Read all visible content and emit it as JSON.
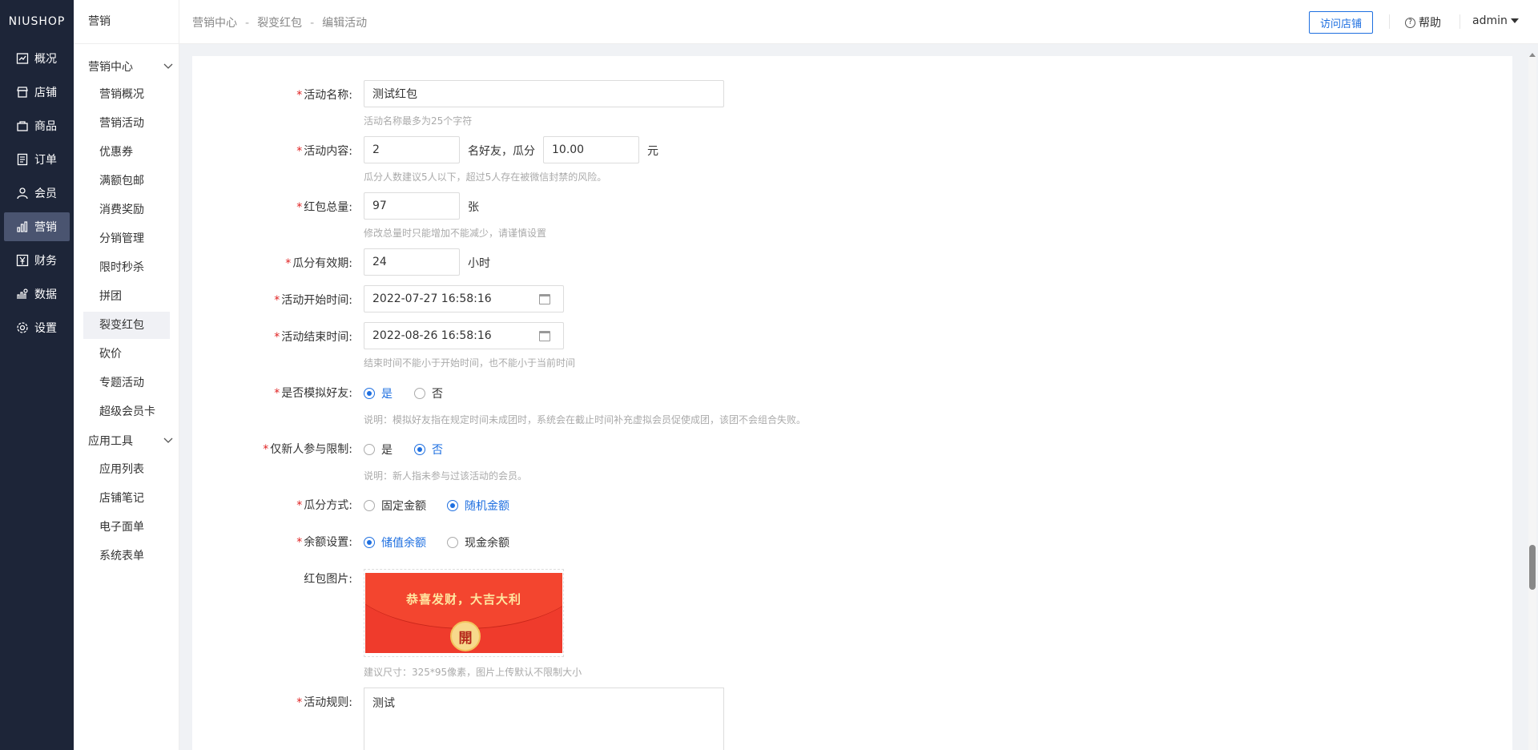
{
  "brand": "NIUSHOP",
  "nav": [
    {
      "label": "概况",
      "icon": "chart-line-icon"
    },
    {
      "label": "店铺",
      "icon": "store-icon"
    },
    {
      "label": "商品",
      "icon": "bag-icon"
    },
    {
      "label": "订单",
      "icon": "order-list-icon"
    },
    {
      "label": "会员",
      "icon": "user-icon"
    },
    {
      "label": "营销",
      "icon": "bar-chart-icon"
    },
    {
      "label": "财务",
      "icon": "yen-icon"
    },
    {
      "label": "数据",
      "icon": "data-icon"
    },
    {
      "label": "设置",
      "icon": "gear-icon"
    }
  ],
  "submenu": {
    "title": "营销",
    "group1": "营销中心",
    "group1_items": [
      "营销概况",
      "营销活动",
      "优惠券",
      "满额包邮",
      "消费奖励",
      "分销管理",
      "限时秒杀",
      "拼团",
      "裂变红包",
      "砍价",
      "专题活动",
      "超级会员卡"
    ],
    "group2": "应用工具",
    "group2_items": [
      "应用列表",
      "店铺笔记",
      "电子面单",
      "系统表单"
    ]
  },
  "header": {
    "crumbs": [
      "营销中心",
      "裂变红包",
      "编辑活动"
    ],
    "visit_store": "访问店铺",
    "help": "帮助",
    "user": "admin"
  },
  "form": {
    "name_label": "活动名称:",
    "name_value": "测试红包",
    "name_hint": "活动名称最多为25个字符",
    "content_label": "活动内容:",
    "content_count": "2",
    "content_mid": "名好友，瓜分",
    "content_amount": "10.00",
    "content_unit": "元",
    "content_hint": "瓜分人数建议5人以下，超过5人存在被微信封禁的风险。",
    "total_label": "红包总量:",
    "total_value": "97",
    "total_unit": "张",
    "total_hint": "修改总量时只能增加不能减少，请谨慎设置",
    "valid_label": "瓜分有效期:",
    "valid_value": "24",
    "valid_unit": "小时",
    "start_label": "活动开始时间:",
    "start_value": "2022-07-27 16:58:16",
    "end_label": "活动结束时间:",
    "end_value": "2022-08-26 16:58:16",
    "time_hint": "结束时间不能小于开始时间，也不能小于当前时间",
    "simulate_label": "是否模拟好友:",
    "simulate_yes": "是",
    "simulate_no": "否",
    "simulate_hint": "说明：模拟好友指在规定时间未成团时，系统会在截止时间补充虚拟会员促使成团，该团不会组合失败。",
    "newbie_label": "仅新人参与限制:",
    "newbie_yes": "是",
    "newbie_no": "否",
    "newbie_hint": "说明：新人指未参与过该活动的会员。",
    "split_label": "瓜分方式:",
    "split_fixed": "固定金额",
    "split_random": "随机金额",
    "balance_label": "余额设置:",
    "balance_stored": "储值余额",
    "balance_cash": "现金余额",
    "image_label": "红包图片:",
    "envelope_text": "恭喜发财，大吉大利",
    "envelope_button": "開",
    "image_hint": "建议尺寸：325*95像素，图片上传默认不限制大小",
    "rules_label": "活动规则:",
    "rules_value": "测试"
  },
  "colors": {
    "accent": "#1e6fe0",
    "nav_bg": "#1d2538",
    "required": "#e02020",
    "envelope": "#ef3b2c"
  }
}
